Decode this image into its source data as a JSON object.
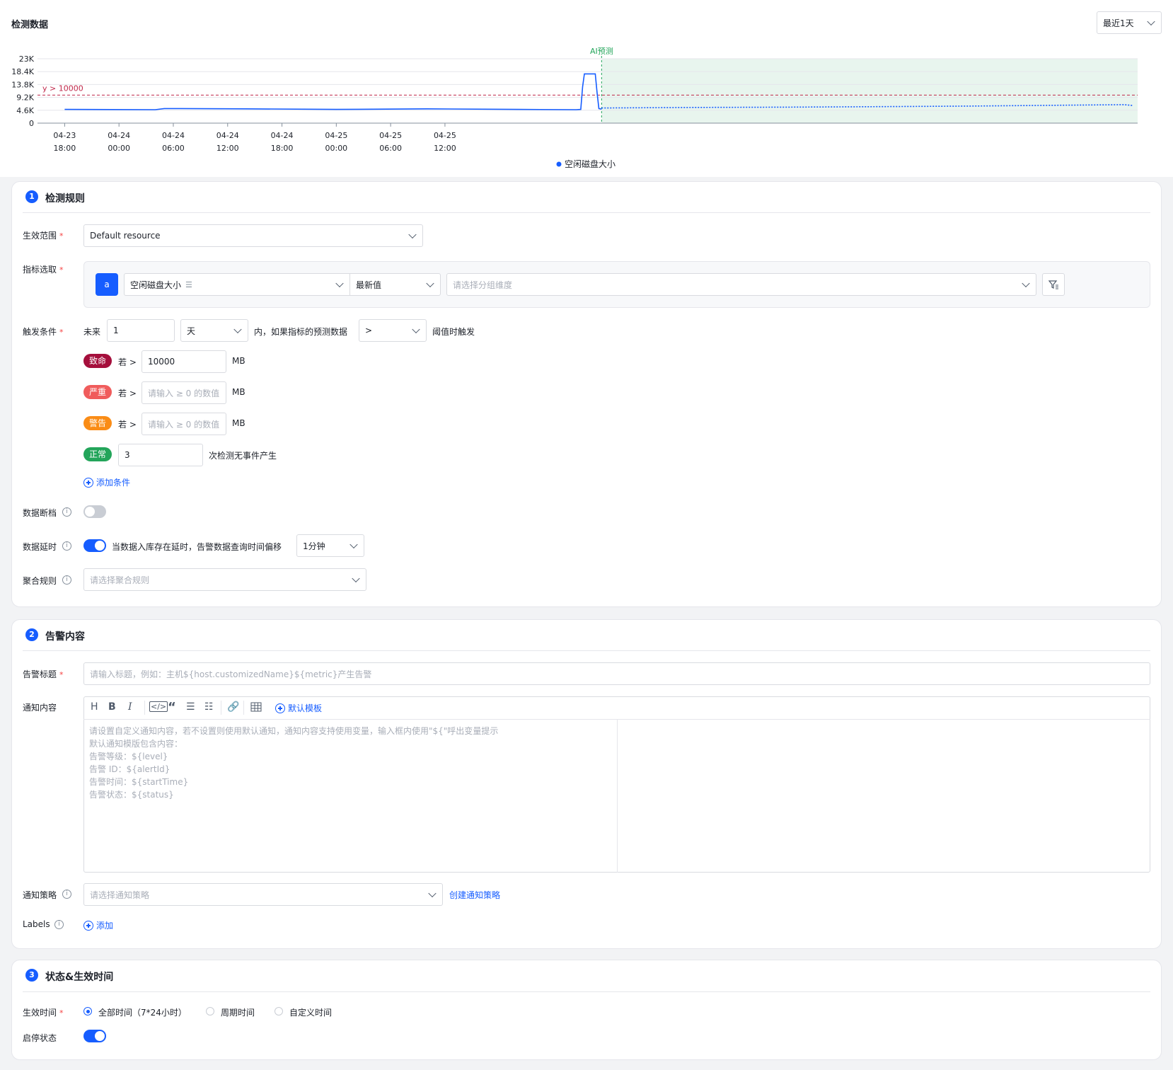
{
  "chart_section": {
    "title": "检测数据",
    "range_select": "最近1天"
  },
  "chart_data": {
    "type": "line",
    "y_ticks": [
      "23K",
      "18.4K",
      "13.8K",
      "9.2K",
      "4.6K",
      "0"
    ],
    "x_ticks": [
      [
        "04-23",
        "18:00"
      ],
      [
        "04-24",
        "00:00"
      ],
      [
        "04-24",
        "06:00"
      ],
      [
        "04-24",
        "12:00"
      ],
      [
        "04-24",
        "18:00"
      ],
      [
        "04-25",
        "00:00"
      ],
      [
        "04-25",
        "06:00"
      ],
      [
        "04-25",
        "12:00"
      ]
    ],
    "threshold_label": "y > 10000",
    "threshold": 10000,
    "ylim": [
      0,
      23000
    ],
    "forecast_label": "AI预测",
    "legend": "空闲磁盘大小",
    "series": [
      {
        "name": "空闲磁盘大小",
        "x_hours": [
          0,
          10,
          11,
          20,
          30,
          40,
          50,
          56.5,
          57,
          57.2,
          57.4,
          58.6,
          58.8,
          59,
          59.3
        ],
        "values": [
          4900,
          4800,
          5200,
          5100,
          4900,
          5100,
          4900,
          4800,
          4900,
          13000,
          17600,
          17600,
          11000,
          5200,
          5000
        ]
      },
      {
        "name": "forecast",
        "x_hours": [
          59.3,
          70,
          80,
          90,
          100,
          110,
          117,
          118
        ],
        "values": [
          5400,
          5600,
          5700,
          5900,
          6100,
          6400,
          6600,
          6300
        ]
      }
    ],
    "x_hours_range": [
      -3,
      118.5
    ],
    "forecast_start_hour": 59.3
  },
  "section1": {
    "num": "1",
    "title": "检测规则",
    "scope_label": "生效范围",
    "scope_value": "Default resource",
    "metric_label": "指标选取",
    "metric_alias": "a",
    "metric_name": "空闲磁盘大小",
    "metric_agg": "最新值",
    "group_placeholder": "请选择分组维度",
    "trigger_label": "触发条件",
    "future": "未来",
    "future_value": "1",
    "unit": "天",
    "mid_text": "内，如果指标的预测数据",
    "operator": ">",
    "end_text": "阈值时触发",
    "levels": [
      {
        "tag": "致命",
        "if": "若 >",
        "value": "10000",
        "placeholder": "",
        "unit": "MB",
        "color": "#a50f3c"
      },
      {
        "tag": "严重",
        "if": "若 >",
        "value": "",
        "placeholder": "请输入 ≥ 0 的数值",
        "unit": "MB",
        "color": "#f05c5c"
      },
      {
        "tag": "警告",
        "if": "若 >",
        "value": "",
        "placeholder": "请输入 ≥ 0 的数值",
        "unit": "MB",
        "color": "#fa8c16"
      }
    ],
    "normal_tag": "正常",
    "normal_value": "3",
    "normal_text": "次检测无事件产生",
    "add_condition": "添加条件",
    "gap_label": "数据断档",
    "delay_label": "数据延时",
    "delay_text": "当数据入库存在延时，告警数据查询时间偏移",
    "delay_value": "1分钟",
    "agg_label": "聚合规则",
    "agg_placeholder": "请选择聚合规则"
  },
  "section2": {
    "num": "2",
    "title": "告警内容",
    "alert_title_label": "告警标题",
    "alert_title_placeholder": "请输入标题，例如：主机${host.customizedName}${metric}产生告警",
    "notify_label": "通知内容",
    "default_template": "默认模板",
    "editor_placeholder": "请设置自定义通知内容，若不设置则使用默认通知，通知内容支持使用变量，输入框内使用\"${\"呼出变量提示\n默认通知模版包含内容：\n告警等级：${level}\n告警 ID：${alertId}\n告警时间：${startTime}\n告警状态：${status}",
    "policy_label": "通知策略",
    "policy_placeholder": "请选择通知策略",
    "create_policy": "创建通知策略",
    "labels_label": "Labels",
    "add": "添加"
  },
  "section3": {
    "num": "3",
    "title": "状态&生效时间",
    "time_label": "生效时间",
    "options": [
      "全部时间（7*24小时）",
      "周期时间",
      "自定义时间"
    ],
    "status_label": "启停状态"
  },
  "colors": {
    "primary": "#165dff",
    "threshold": "#c0284a",
    "forecast": "#23a55a"
  }
}
